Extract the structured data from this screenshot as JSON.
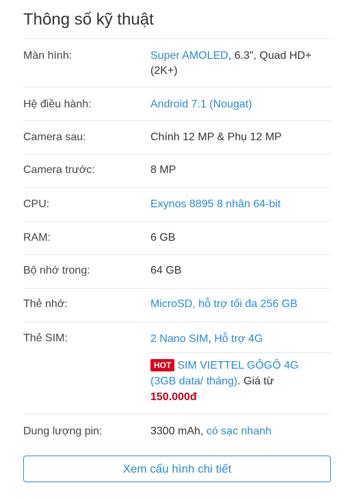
{
  "title": "Thông số kỹ thuật",
  "colors": {
    "link": "#288ad6",
    "hot_badge": "#e0001a",
    "price": "#c4001a"
  },
  "specs": {
    "screen": {
      "label": "Màn hình:",
      "link": "Super AMOLED",
      "text": ", 6.3\", Quad HD+ (2K+)"
    },
    "os": {
      "label": "Hệ điều hành:",
      "link": "Android 7.1 (Nougat)"
    },
    "rear_camera": {
      "label": "Camera sau:",
      "text": "Chính 12 MP & Phụ 12 MP"
    },
    "front_camera": {
      "label": "Camera trước:",
      "text": "8 MP"
    },
    "cpu": {
      "label": "CPU:",
      "link": "Exynos 8895 8 nhân 64-bit"
    },
    "ram": {
      "label": "RAM:",
      "text": "6 GB"
    },
    "storage": {
      "label": "Bộ nhớ trong:",
      "text": "64 GB"
    },
    "memory_card": {
      "label": "Thẻ nhớ:",
      "link": "MicroSD, hỗ trợ tối đa 256 GB"
    },
    "sim": {
      "label": "Thẻ SIM:",
      "link1": "2 Nano SIM",
      "sep": ", ",
      "link2": "Hỗ trợ 4G",
      "promo": {
        "badge": "HOT",
        "link": "SIM VIETTEL GÔGÔ 4G (3GB data/ tháng)",
        "text": ". Giá từ",
        "price": "150.000đ"
      }
    },
    "battery": {
      "label": "Dung lượng pin:",
      "text": "3300 mAh, ",
      "link": "có sạc nhanh"
    }
  },
  "detail_button": "Xem cấu hình chi tiết"
}
